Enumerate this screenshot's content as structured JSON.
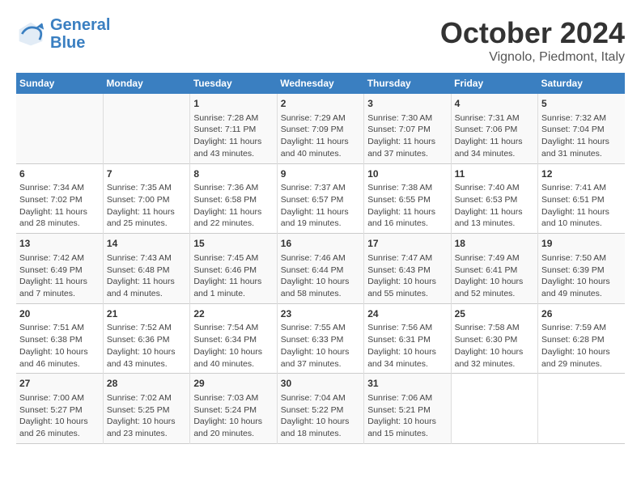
{
  "header": {
    "logo_line1": "General",
    "logo_line2": "Blue",
    "month": "October 2024",
    "location": "Vignolo, Piedmont, Italy"
  },
  "days_of_week": [
    "Sunday",
    "Monday",
    "Tuesday",
    "Wednesday",
    "Thursday",
    "Friday",
    "Saturday"
  ],
  "weeks": [
    [
      {
        "day": "",
        "info": ""
      },
      {
        "day": "",
        "info": ""
      },
      {
        "day": "1",
        "info": "Sunrise: 7:28 AM\nSunset: 7:11 PM\nDaylight: 11 hours and 43 minutes."
      },
      {
        "day": "2",
        "info": "Sunrise: 7:29 AM\nSunset: 7:09 PM\nDaylight: 11 hours and 40 minutes."
      },
      {
        "day": "3",
        "info": "Sunrise: 7:30 AM\nSunset: 7:07 PM\nDaylight: 11 hours and 37 minutes."
      },
      {
        "day": "4",
        "info": "Sunrise: 7:31 AM\nSunset: 7:06 PM\nDaylight: 11 hours and 34 minutes."
      },
      {
        "day": "5",
        "info": "Sunrise: 7:32 AM\nSunset: 7:04 PM\nDaylight: 11 hours and 31 minutes."
      }
    ],
    [
      {
        "day": "6",
        "info": "Sunrise: 7:34 AM\nSunset: 7:02 PM\nDaylight: 11 hours and 28 minutes."
      },
      {
        "day": "7",
        "info": "Sunrise: 7:35 AM\nSunset: 7:00 PM\nDaylight: 11 hours and 25 minutes."
      },
      {
        "day": "8",
        "info": "Sunrise: 7:36 AM\nSunset: 6:58 PM\nDaylight: 11 hours and 22 minutes."
      },
      {
        "day": "9",
        "info": "Sunrise: 7:37 AM\nSunset: 6:57 PM\nDaylight: 11 hours and 19 minutes."
      },
      {
        "day": "10",
        "info": "Sunrise: 7:38 AM\nSunset: 6:55 PM\nDaylight: 11 hours and 16 minutes."
      },
      {
        "day": "11",
        "info": "Sunrise: 7:40 AM\nSunset: 6:53 PM\nDaylight: 11 hours and 13 minutes."
      },
      {
        "day": "12",
        "info": "Sunrise: 7:41 AM\nSunset: 6:51 PM\nDaylight: 11 hours and 10 minutes."
      }
    ],
    [
      {
        "day": "13",
        "info": "Sunrise: 7:42 AM\nSunset: 6:49 PM\nDaylight: 11 hours and 7 minutes."
      },
      {
        "day": "14",
        "info": "Sunrise: 7:43 AM\nSunset: 6:48 PM\nDaylight: 11 hours and 4 minutes."
      },
      {
        "day": "15",
        "info": "Sunrise: 7:45 AM\nSunset: 6:46 PM\nDaylight: 11 hours and 1 minute."
      },
      {
        "day": "16",
        "info": "Sunrise: 7:46 AM\nSunset: 6:44 PM\nDaylight: 10 hours and 58 minutes."
      },
      {
        "day": "17",
        "info": "Sunrise: 7:47 AM\nSunset: 6:43 PM\nDaylight: 10 hours and 55 minutes."
      },
      {
        "day": "18",
        "info": "Sunrise: 7:49 AM\nSunset: 6:41 PM\nDaylight: 10 hours and 52 minutes."
      },
      {
        "day": "19",
        "info": "Sunrise: 7:50 AM\nSunset: 6:39 PM\nDaylight: 10 hours and 49 minutes."
      }
    ],
    [
      {
        "day": "20",
        "info": "Sunrise: 7:51 AM\nSunset: 6:38 PM\nDaylight: 10 hours and 46 minutes."
      },
      {
        "day": "21",
        "info": "Sunrise: 7:52 AM\nSunset: 6:36 PM\nDaylight: 10 hours and 43 minutes."
      },
      {
        "day": "22",
        "info": "Sunrise: 7:54 AM\nSunset: 6:34 PM\nDaylight: 10 hours and 40 minutes."
      },
      {
        "day": "23",
        "info": "Sunrise: 7:55 AM\nSunset: 6:33 PM\nDaylight: 10 hours and 37 minutes."
      },
      {
        "day": "24",
        "info": "Sunrise: 7:56 AM\nSunset: 6:31 PM\nDaylight: 10 hours and 34 minutes."
      },
      {
        "day": "25",
        "info": "Sunrise: 7:58 AM\nSunset: 6:30 PM\nDaylight: 10 hours and 32 minutes."
      },
      {
        "day": "26",
        "info": "Sunrise: 7:59 AM\nSunset: 6:28 PM\nDaylight: 10 hours and 29 minutes."
      }
    ],
    [
      {
        "day": "27",
        "info": "Sunrise: 7:00 AM\nSunset: 5:27 PM\nDaylight: 10 hours and 26 minutes."
      },
      {
        "day": "28",
        "info": "Sunrise: 7:02 AM\nSunset: 5:25 PM\nDaylight: 10 hours and 23 minutes."
      },
      {
        "day": "29",
        "info": "Sunrise: 7:03 AM\nSunset: 5:24 PM\nDaylight: 10 hours and 20 minutes."
      },
      {
        "day": "30",
        "info": "Sunrise: 7:04 AM\nSunset: 5:22 PM\nDaylight: 10 hours and 18 minutes."
      },
      {
        "day": "31",
        "info": "Sunrise: 7:06 AM\nSunset: 5:21 PM\nDaylight: 10 hours and 15 minutes."
      },
      {
        "day": "",
        "info": ""
      },
      {
        "day": "",
        "info": ""
      }
    ]
  ]
}
